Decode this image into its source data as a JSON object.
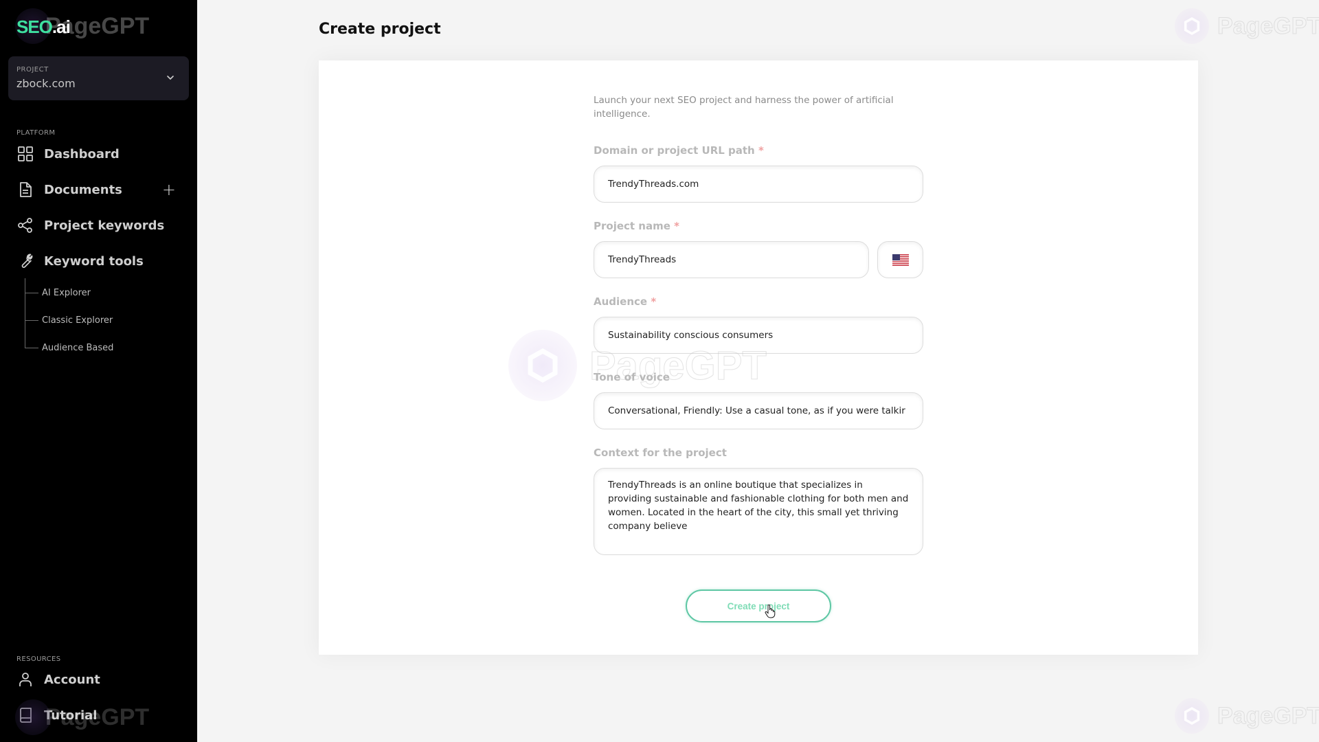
{
  "app": {
    "logo_main": "SEO",
    "logo_suffix": ".ai",
    "watermark": "PageGPT"
  },
  "sidebar": {
    "project_selector": {
      "label": "PROJECT",
      "value": "zbock.com"
    },
    "platform_label": "PLATFORM",
    "platform_items": [
      {
        "label": "Dashboard",
        "icon": "dashboard-grid-icon"
      },
      {
        "label": "Documents",
        "icon": "document-icon",
        "action": "+"
      },
      {
        "label": "Project keywords",
        "icon": "share-nodes-icon"
      },
      {
        "label": "Keyword tools",
        "icon": "wrench-icon"
      }
    ],
    "keyword_tools_sub": [
      {
        "label": "AI Explorer"
      },
      {
        "label": "Classic Explorer"
      },
      {
        "label": "Audience Based"
      }
    ],
    "resources_label": "RESOURCES",
    "resources_items": [
      {
        "label": "Account",
        "icon": "user-icon"
      },
      {
        "label": "Tutorial",
        "icon": "book-icon"
      }
    ]
  },
  "main": {
    "title": "Create project",
    "intro": "Launch your next SEO project and harness the power of artificial intelligence.",
    "fields": {
      "domain": {
        "label": "Domain or project URL path",
        "required": "*",
        "value": "TrendyThreads.com"
      },
      "project_name": {
        "label": "Project name",
        "required": "*",
        "value": "TrendyThreads",
        "country": "United States"
      },
      "audience": {
        "label": "Audience",
        "required": "*",
        "value": "Sustainability conscious consumers"
      },
      "tone": {
        "label": "Tone of voice",
        "value": "Conversational, Friendly: Use a casual tone, as if you were talkir"
      },
      "context": {
        "label": "Context for the project",
        "value": "TrendyThreads is an online boutique that specializes in providing sustainable and fashionable clothing for both men and women. Located in the heart of the city, this small yet thriving company believe"
      }
    },
    "submit_label": "Create project"
  },
  "colors": {
    "brand_green": "#3ee0a0",
    "sidebar_bg": "#000000",
    "button_border": "#5ec7a4",
    "required_star": "#f0a0a0"
  }
}
